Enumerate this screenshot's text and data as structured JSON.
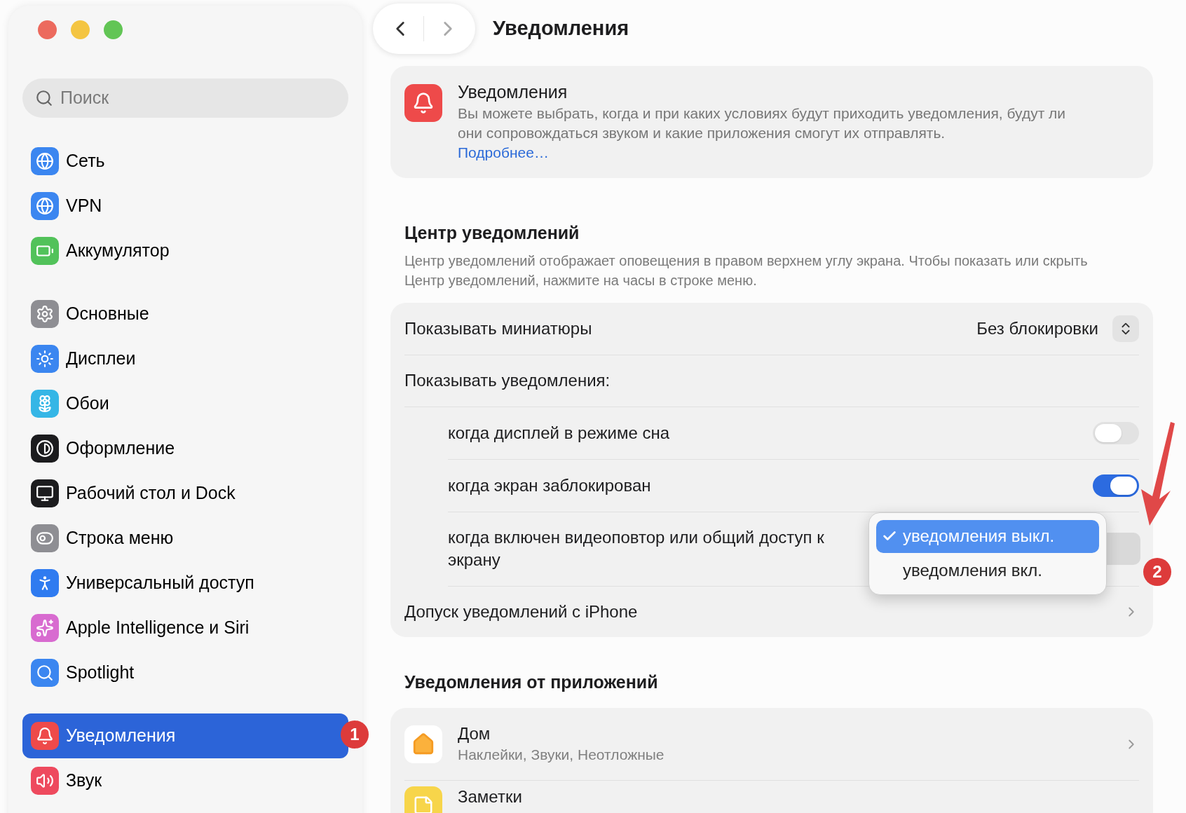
{
  "sidebar": {
    "search": {
      "placeholder": "Поиск"
    },
    "groups": [
      [
        {
          "label": "Сеть",
          "selected": false
        },
        {
          "label": "VPN",
          "selected": false
        },
        {
          "label": "Аккумулятор",
          "selected": false
        }
      ],
      [
        {
          "label": "Основные",
          "selected": false
        },
        {
          "label": "Дисплеи",
          "selected": false
        },
        {
          "label": "Обои",
          "selected": false
        },
        {
          "label": "Оформление",
          "selected": false
        },
        {
          "label": "Рабочий стол и Dock",
          "selected": false
        },
        {
          "label": "Строка меню",
          "selected": false
        },
        {
          "label": "Универсальный доступ",
          "selected": false
        },
        {
          "label": "Apple Intelligence и Siri",
          "selected": false
        },
        {
          "label": "Spotlight",
          "selected": false
        }
      ],
      [
        {
          "label": "Уведомления",
          "selected": true
        },
        {
          "label": "Звук",
          "selected": false
        }
      ]
    ]
  },
  "title": "Уведомления",
  "intro": {
    "title": "Уведомления",
    "description": "Вы можете выбрать, когда и при каких условиях будут приходить уведомления, будут ли они сопровождаться звуком и какие приложения смогут их отправлять.",
    "link": "Подробнее…"
  },
  "notification_center": {
    "heading": "Центр уведомлений",
    "description": "Центр уведомлений отображает оповещения в правом верхнем углу экрана. Чтобы показать или скрыть Центр уведомлений, нажмите на часы в строке меню.",
    "rows": [
      {
        "kind": "select",
        "label": "Показывать миниатюры",
        "value": "Без блокировки"
      },
      {
        "kind": "header",
        "label": "Показывать уведомления:"
      },
      {
        "kind": "toggle",
        "label": "когда дисплей в режиме сна",
        "on": false
      },
      {
        "kind": "toggle",
        "label": "когда экран заблокирован",
        "on": true
      },
      {
        "kind": "popup",
        "label": "когда включен видеоповтор или общий доступ к экрану",
        "options": [
          {
            "label": "уведомления выкл.",
            "selected": true
          },
          {
            "label": "уведомления вкл.",
            "selected": false
          }
        ]
      },
      {
        "kind": "link",
        "label": "Допуск уведомлений с iPhone"
      }
    ]
  },
  "apps": {
    "heading": "Уведомления от приложений",
    "items": [
      {
        "name": "Дом",
        "subtitle": "Наклейки, Звуки, Неотложные"
      },
      {
        "name": "Заметки"
      }
    ]
  },
  "annotations": [
    {
      "label": "1"
    },
    {
      "label": "2"
    }
  ]
}
